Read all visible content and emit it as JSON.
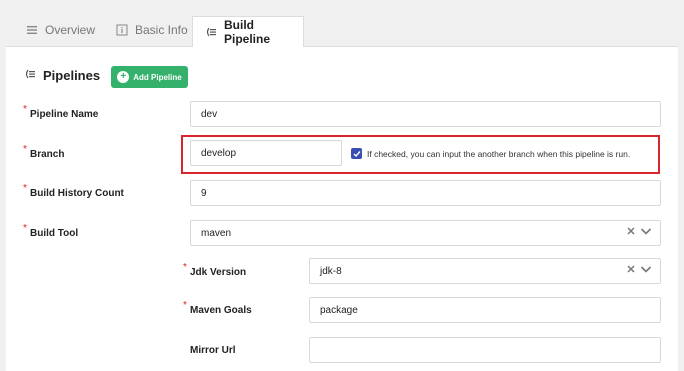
{
  "tabs": [
    {
      "label": "Overview",
      "icon": "list-icon",
      "active": false
    },
    {
      "label": "Basic Info",
      "icon": "info-icon",
      "active": false
    },
    {
      "label": "Build Pipeline",
      "icon": "pipeline-icon",
      "active": true
    }
  ],
  "section": {
    "title": "Pipelines",
    "add_button": "Add Pipeline"
  },
  "fields": {
    "pipeline_name": {
      "label": "Pipeline Name",
      "value": "dev",
      "required": true
    },
    "branch": {
      "label": "Branch",
      "value": "develop",
      "required": true,
      "checkbox_checked": true,
      "checkbox_text": "If checked, you can input the another branch when this pipeline is run."
    },
    "build_history_count": {
      "label": "Build History Count",
      "value": "9",
      "required": true
    },
    "build_tool": {
      "label": "Build Tool",
      "value": "maven",
      "required": true
    },
    "jdk_version": {
      "label": "Jdk Version",
      "value": "jdk-8",
      "required": true
    },
    "maven_goals": {
      "label": "Maven Goals",
      "value": "package",
      "required": true
    },
    "mirror_url": {
      "label": "Mirror Url",
      "value": "",
      "required": false
    }
  },
  "colors": {
    "accent_green": "#34b16a",
    "highlight_red": "#d9262c",
    "required_red": "#e02020",
    "checkbox_blue": "#3a4fb3"
  }
}
